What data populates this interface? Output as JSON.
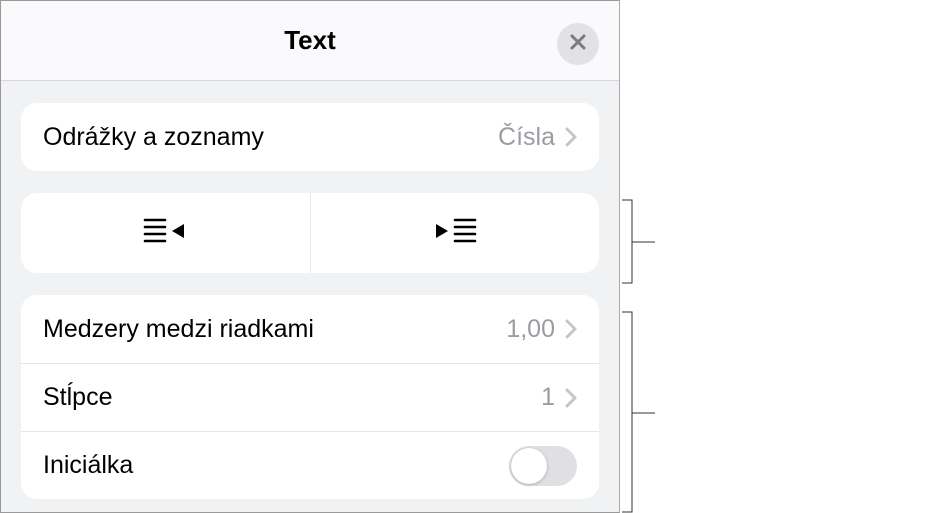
{
  "header": {
    "title": "Text"
  },
  "bullets": {
    "label": "Odrážky a zoznamy",
    "value": "Čísla"
  },
  "line_spacing": {
    "label": "Medzery medzi riadkami",
    "value": "1,00"
  },
  "columns": {
    "label": "Stĺpce",
    "value": "1"
  },
  "drop_cap": {
    "label": "Iniciálka",
    "on": false
  }
}
